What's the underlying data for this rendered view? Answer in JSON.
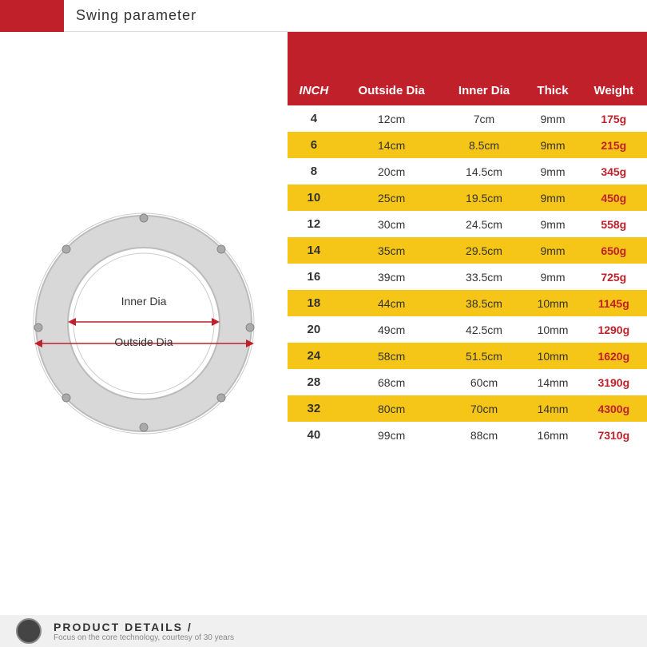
{
  "header": {
    "title": "Swing parameter"
  },
  "diagram": {
    "inner_dia_label": "Inner Dia",
    "outside_dia_label": "Outside Dia"
  },
  "table": {
    "headers": [
      "INCH",
      "Outside Dia",
      "Inner Dia",
      "Thick",
      "Weight"
    ],
    "rows": [
      [
        "4",
        "12cm",
        "7cm",
        "9mm",
        "175g"
      ],
      [
        "6",
        "14cm",
        "8.5cm",
        "9mm",
        "215g"
      ],
      [
        "8",
        "20cm",
        "14.5cm",
        "9mm",
        "345g"
      ],
      [
        "10",
        "25cm",
        "19.5cm",
        "9mm",
        "450g"
      ],
      [
        "12",
        "30cm",
        "24.5cm",
        "9mm",
        "558g"
      ],
      [
        "14",
        "35cm",
        "29.5cm",
        "9mm",
        "650g"
      ],
      [
        "16",
        "39cm",
        "33.5cm",
        "9mm",
        "725g"
      ],
      [
        "18",
        "44cm",
        "38.5cm",
        "10mm",
        "1145g"
      ],
      [
        "20",
        "49cm",
        "42.5cm",
        "10mm",
        "1290g"
      ],
      [
        "24",
        "58cm",
        "51.5cm",
        "10mm",
        "1620g"
      ],
      [
        "28",
        "68cm",
        "60cm",
        "14mm",
        "3190g"
      ],
      [
        "32",
        "80cm",
        "70cm",
        "14mm",
        "4300g"
      ],
      [
        "40",
        "99cm",
        "88cm",
        "16mm",
        "7310g"
      ]
    ]
  },
  "footer": {
    "title": "PRODUCT DETAILS /",
    "subtitle": "Focus on the core technology, courtesy of 30 years"
  }
}
